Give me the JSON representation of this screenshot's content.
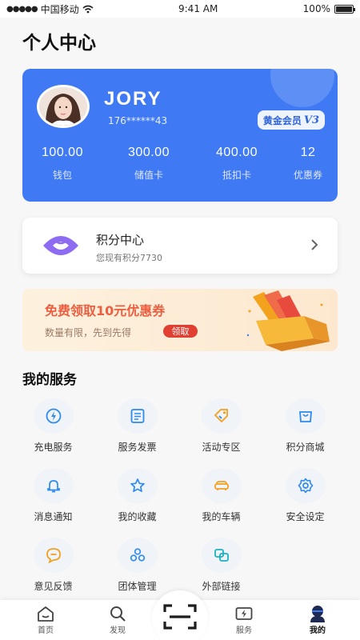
{
  "status_bar": {
    "carrier": "中国移动",
    "time": "9:41 AM",
    "battery": "100%",
    "battery_level": 1.0
  },
  "page_title": "个人中心",
  "profile": {
    "name": "JORY",
    "phone": "176******43",
    "vip_label": "黄金会员",
    "vip_level": "V3",
    "stats": [
      {
        "value": "100.00",
        "label": "钱包"
      },
      {
        "value": "300.00",
        "label": "储值卡"
      },
      {
        "value": "400.00",
        "label": "抵扣卡"
      },
      {
        "value": "12",
        "label": "优惠券"
      }
    ]
  },
  "points": {
    "title": "积分中心",
    "subtitle": "您现有积分7730"
  },
  "coupon": {
    "title": "免费领取10元优惠券",
    "subtitle": "数量有限，先到先得",
    "button": "领取"
  },
  "services_title": "我的服务",
  "services": [
    {
      "label": "充电服务",
      "icon": "charge-icon"
    },
    {
      "label": "服务发票",
      "icon": "invoice-icon"
    },
    {
      "label": "活动专区",
      "icon": "activity-icon"
    },
    {
      "label": "积分商城",
      "icon": "shop-icon"
    },
    {
      "label": "消息通知",
      "icon": "bell-icon"
    },
    {
      "label": "我的收藏",
      "icon": "star-icon"
    },
    {
      "label": "我的车辆",
      "icon": "car-icon"
    },
    {
      "label": "安全设定",
      "icon": "gear-icon"
    },
    {
      "label": "意见反馈",
      "icon": "feedback-icon"
    },
    {
      "label": "团体管理",
      "icon": "group-icon"
    },
    {
      "label": "外部链接",
      "icon": "link-icon"
    }
  ],
  "tabbar": [
    {
      "label": "首页",
      "icon": "home-icon"
    },
    {
      "label": "发现",
      "icon": "search-icon"
    },
    {
      "label": "",
      "icon": "scan-icon"
    },
    {
      "label": "服务",
      "icon": "service-icon"
    },
    {
      "label": "我的",
      "icon": "profile-icon"
    }
  ],
  "colors": {
    "primary": "#3f7af4",
    "accent": "#ec5e3f",
    "icon_blue": "#2c8af0",
    "icon_orange": "#f2a11e"
  }
}
